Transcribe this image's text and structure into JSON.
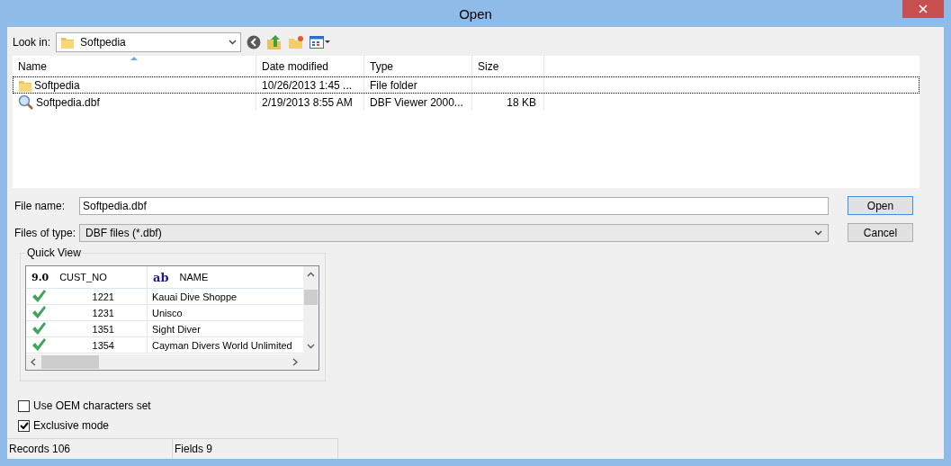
{
  "window": {
    "title": "Open"
  },
  "look_in": {
    "label": "Look in:",
    "value": "Softpedia"
  },
  "file_list": {
    "columns": [
      {
        "label": "Name",
        "sorted": true
      },
      {
        "label": "Date modified",
        "sorted": false
      },
      {
        "label": "Type",
        "sorted": false
      },
      {
        "label": "Size",
        "sorted": false
      }
    ],
    "rows": [
      {
        "kind": "folder",
        "name": "Softpedia",
        "date": "10/26/2013 1:45 ...",
        "type": "File folder",
        "selected": true
      },
      {
        "kind": "dbf",
        "name": "Softpedia.dbf",
        "date": "2/19/2013 8:55 AM",
        "type": "DBF Viewer 2000...",
        "size": "18 KB",
        "selected": false
      }
    ]
  },
  "file_name": {
    "label": "File name:",
    "value": "Softpedia.dbf"
  },
  "file_type": {
    "label": "Files of type:",
    "value": "DBF files (*.dbf)"
  },
  "buttons": [
    {
      "label": "Open",
      "default": true
    },
    {
      "label": "Cancel",
      "default": false
    }
  ],
  "quick_view": {
    "title": "Quick View",
    "columns": [
      {
        "badge": "9.0",
        "kind": "number",
        "label": "CUST_NO"
      },
      {
        "badge": "ab",
        "kind": "text",
        "label": "NAME"
      }
    ],
    "rows": [
      {
        "cust_no": "1221",
        "name": "Kauai Dive Shoppe"
      },
      {
        "cust_no": "1231",
        "name": "Unisco"
      },
      {
        "cust_no": "1351",
        "name": "Sight Diver"
      },
      {
        "cust_no": "1354",
        "name": "Cayman Divers World Unlimited"
      }
    ]
  },
  "options": [
    {
      "label": "Use OEM characters set",
      "checked": false
    },
    {
      "label": "Exclusive mode",
      "checked": true
    }
  ],
  "status_bar": [
    "Records 106",
    "Fields 9"
  ]
}
